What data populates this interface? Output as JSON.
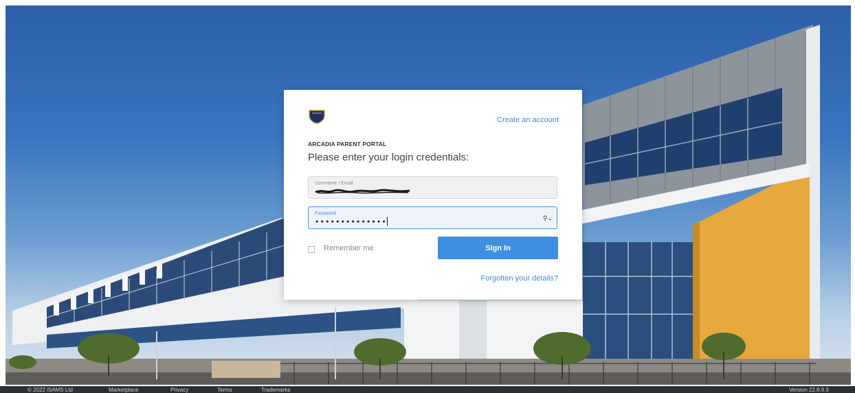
{
  "login": {
    "create_account": "Create an account",
    "portal_name": "ARCADIA PARENT PORTAL",
    "prompt": "Please enter your login credentials:",
    "username_label": "Username / Email",
    "password_label": "Password",
    "password_masked": "••••••••••••••",
    "remember_me": "Remember me",
    "sign_in": "Sign In",
    "forgot": "Forgotten your details?"
  },
  "footer": {
    "copyright": "© 2022 iSAMS Ltd",
    "marketplace": "Marketplace",
    "privacy": "Privacy",
    "terms": "Terms",
    "trademarks": "Trademarks",
    "version": "Version 22.8.9.9"
  },
  "colors": {
    "accent": "#3f8fe0",
    "link": "#3b8ad8",
    "sky": "#2c5fa8",
    "cladding": "#e7a93c"
  },
  "icons": {
    "logo": "shield-crest-icon",
    "password_toggle": "key-dropdown-icon",
    "checkbox": "checkbox-icon"
  }
}
